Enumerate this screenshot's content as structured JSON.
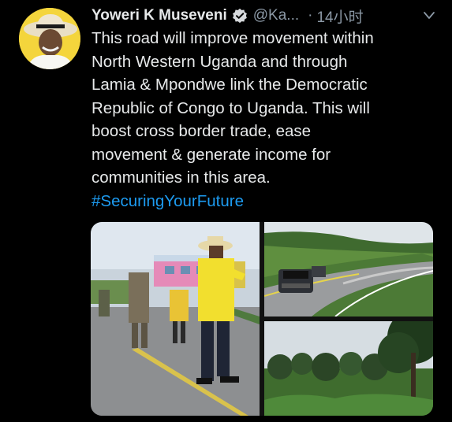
{
  "tweet": {
    "display_name": "Yoweri K Museveni",
    "handle": "@Ka...",
    "separator": "·",
    "time": "14小时",
    "body_lines": [
      "This road will improve movement within",
      "North Western Uganda and through",
      "Lamia & Mpondwe link the Democratic",
      "Republic of Congo to Uganda. This will",
      "boost cross border trade, ease",
      "movement & generate income for",
      "communities in this area."
    ],
    "hashtag": "#SecuringYourFuture"
  },
  "icons": {
    "verified": "verified-badge-icon",
    "more": "chevron-down-icon"
  },
  "colors": {
    "background": "#000000",
    "text": "#e7e9ea",
    "secondary": "#8b98a5",
    "link": "#1d9bf0"
  }
}
